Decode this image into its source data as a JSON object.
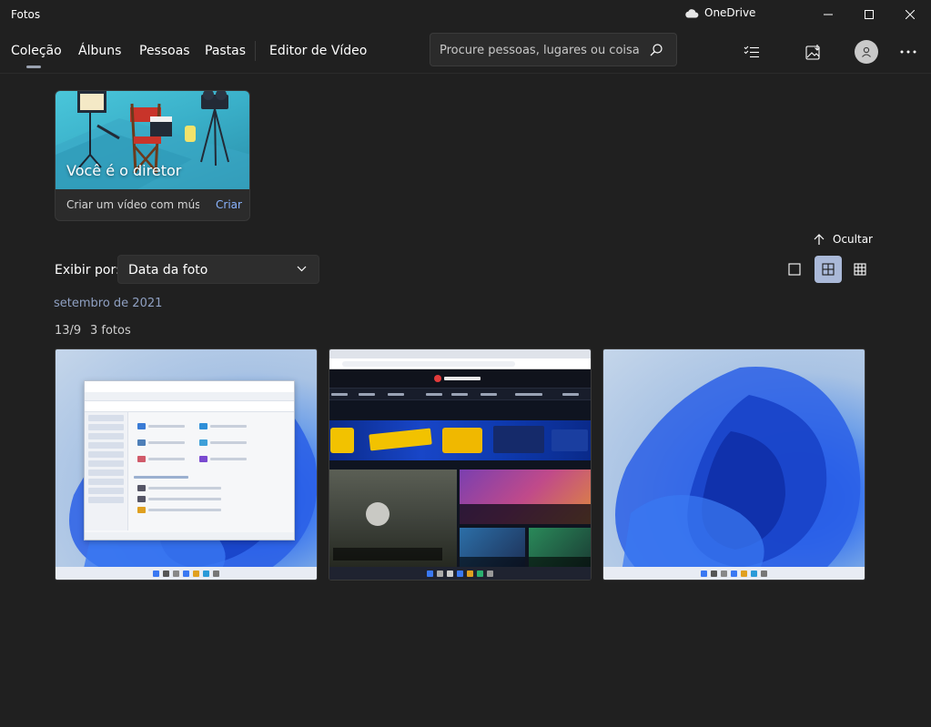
{
  "window": {
    "title": "Fotos",
    "onedrive_label": "OneDrive"
  },
  "nav": {
    "items": [
      "Coleção",
      "Álbuns",
      "Pessoas",
      "Pastas",
      "Editor de Vídeo"
    ],
    "active": "Coleção"
  },
  "search": {
    "placeholder": "Procure pessoas, lugares ou coisas"
  },
  "toolbar": {
    "icons": [
      "select-icon",
      "import-icon",
      "account-avatar-icon",
      "more-icon"
    ]
  },
  "director_card": {
    "title": "Você é o diretor",
    "subtitle": "Criar um vídeo com mús...",
    "action": "Criar"
  },
  "controls": {
    "hide_label": "Ocultar",
    "viewby_label": "Exibir por:",
    "viewby_value": "Data da foto",
    "view_modes": [
      "single",
      "medium",
      "small"
    ],
    "active_view_mode": "medium"
  },
  "gallery": {
    "month": "setembro de 2021",
    "day": "13/9",
    "count": "3 fotos",
    "photos": [
      {
        "name": "explorer-screenshot"
      },
      {
        "name": "browser-screenshot"
      },
      {
        "name": "wallpaper-screenshot"
      }
    ]
  },
  "colors": {
    "background": "#202020",
    "accent_link": "#8ab4ff",
    "month_text": "#8fa0c2",
    "active_view_bg": "#aab9d8"
  }
}
